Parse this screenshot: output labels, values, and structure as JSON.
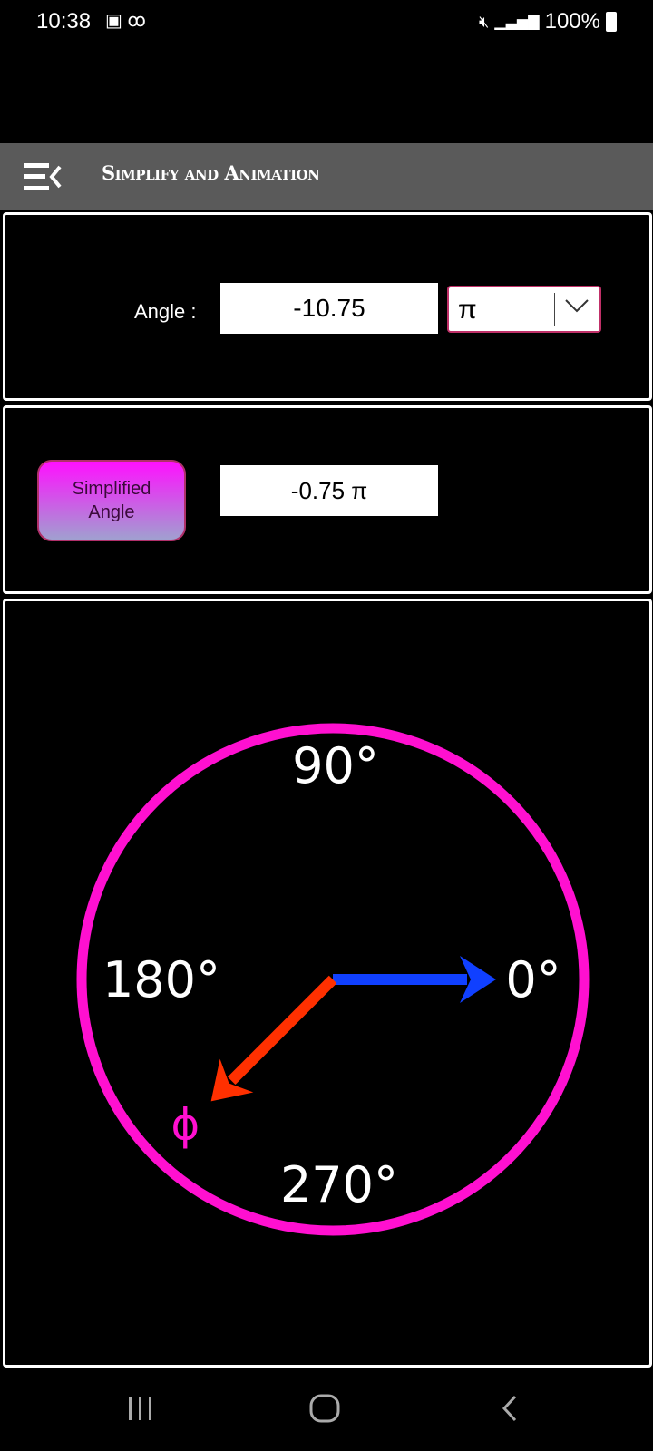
{
  "status_bar": {
    "time": "10:38",
    "battery": "100%",
    "icons": [
      "gallery-icon",
      "voicemail-icon",
      "mute-icon",
      "signal-icon",
      "battery-icon"
    ]
  },
  "app_bar": {
    "title": "Simplify and Animation",
    "menu_icon": "menu-collapse-icon"
  },
  "input_panel": {
    "angle_label": "Angle :",
    "angle_value": "-10.75",
    "unit_selected": "π"
  },
  "result_panel": {
    "button_label_line1": "Simplified",
    "button_label_line2": "Angle",
    "result_value": "-0.75 π"
  },
  "dial": {
    "labels": {
      "deg90": "90°",
      "deg180": "180°",
      "deg0": "0°",
      "deg270": "270°"
    },
    "phi_label": "ϕ",
    "angle_pi": -0.75,
    "ring_color": "#ff10d0",
    "reference_arrow_color": "#1040ff",
    "angle_arrow_color": "#ff3000"
  },
  "nav_bar": {
    "icons": [
      "recents-icon",
      "home-icon",
      "back-icon"
    ]
  }
}
